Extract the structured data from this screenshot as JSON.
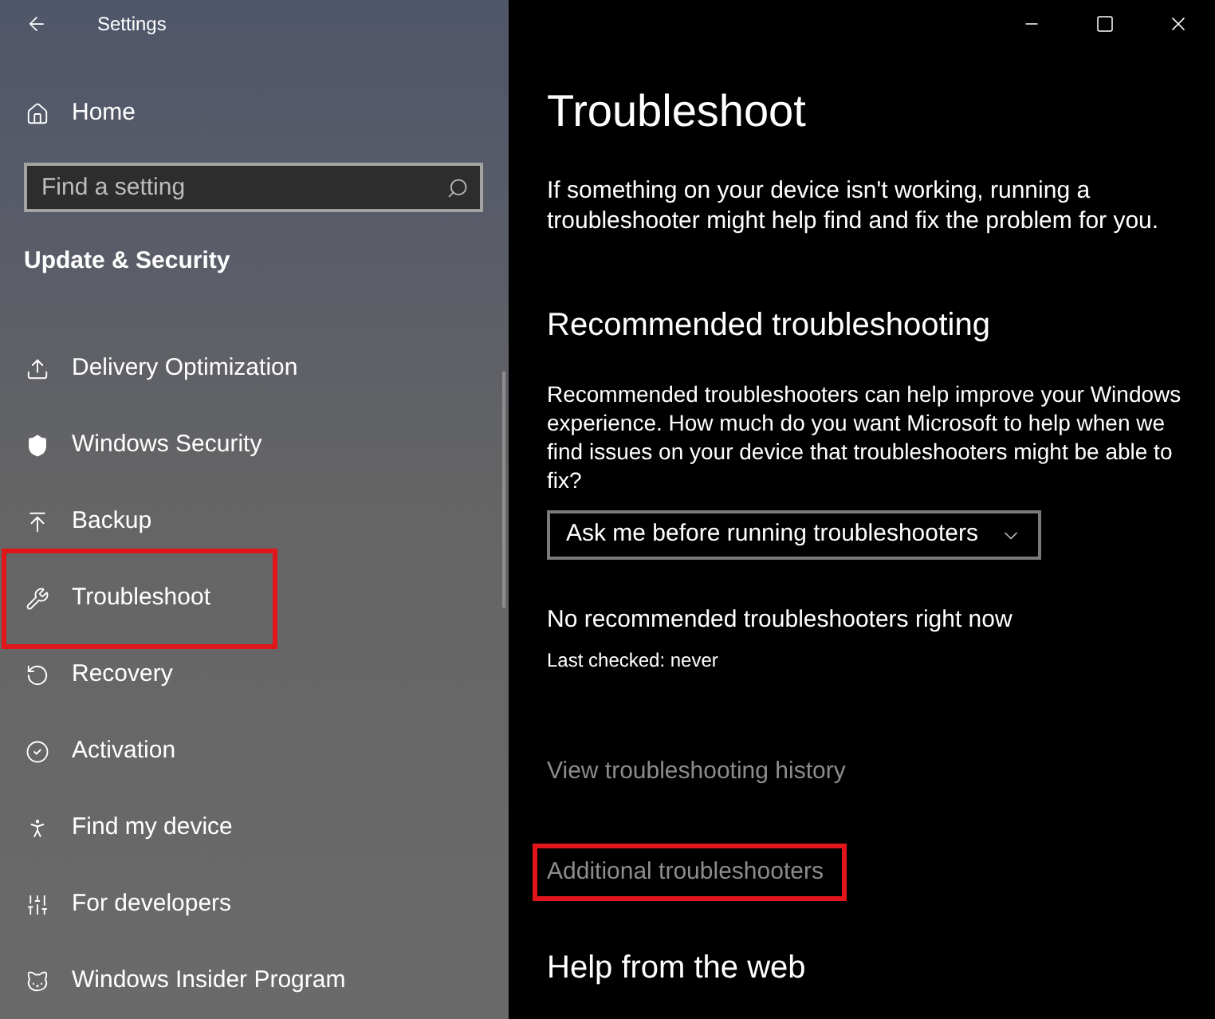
{
  "window": {
    "title": "Settings"
  },
  "sidebar": {
    "home": "Home",
    "search": {
      "placeholder": "Find a setting"
    },
    "section": "Update & Security",
    "items": [
      {
        "label": "Delivery Optimization",
        "highlighted": false
      },
      {
        "label": "Windows Security",
        "highlighted": false
      },
      {
        "label": "Backup",
        "highlighted": false
      },
      {
        "label": "Troubleshoot",
        "highlighted": true
      },
      {
        "label": "Recovery",
        "highlighted": false
      },
      {
        "label": "Activation",
        "highlighted": false
      },
      {
        "label": "Find my device",
        "highlighted": false
      },
      {
        "label": "For developers",
        "highlighted": false
      },
      {
        "label": "Windows Insider Program",
        "highlighted": false
      }
    ]
  },
  "page": {
    "title": "Troubleshoot",
    "description": "If something on your device isn't working, running a troubleshooter might help find and fix the problem for you.",
    "recommended": {
      "heading": "Recommended troubleshooting",
      "text": "Recommended troubleshooters can help improve your Windows experience. How much do you want Microsoft to help when we find issues on your device that troubleshooters might be able to fix?",
      "dropdown": {
        "value": "Ask me before running troubleshooters"
      },
      "status": "No recommended troubleshooters right now",
      "last_checked": "Last checked: never"
    },
    "links": [
      {
        "label": "View troubleshooting history",
        "highlighted": false
      },
      {
        "label": "Additional troubleshooters",
        "highlighted": true
      }
    ],
    "help_heading": "Help from the web"
  }
}
